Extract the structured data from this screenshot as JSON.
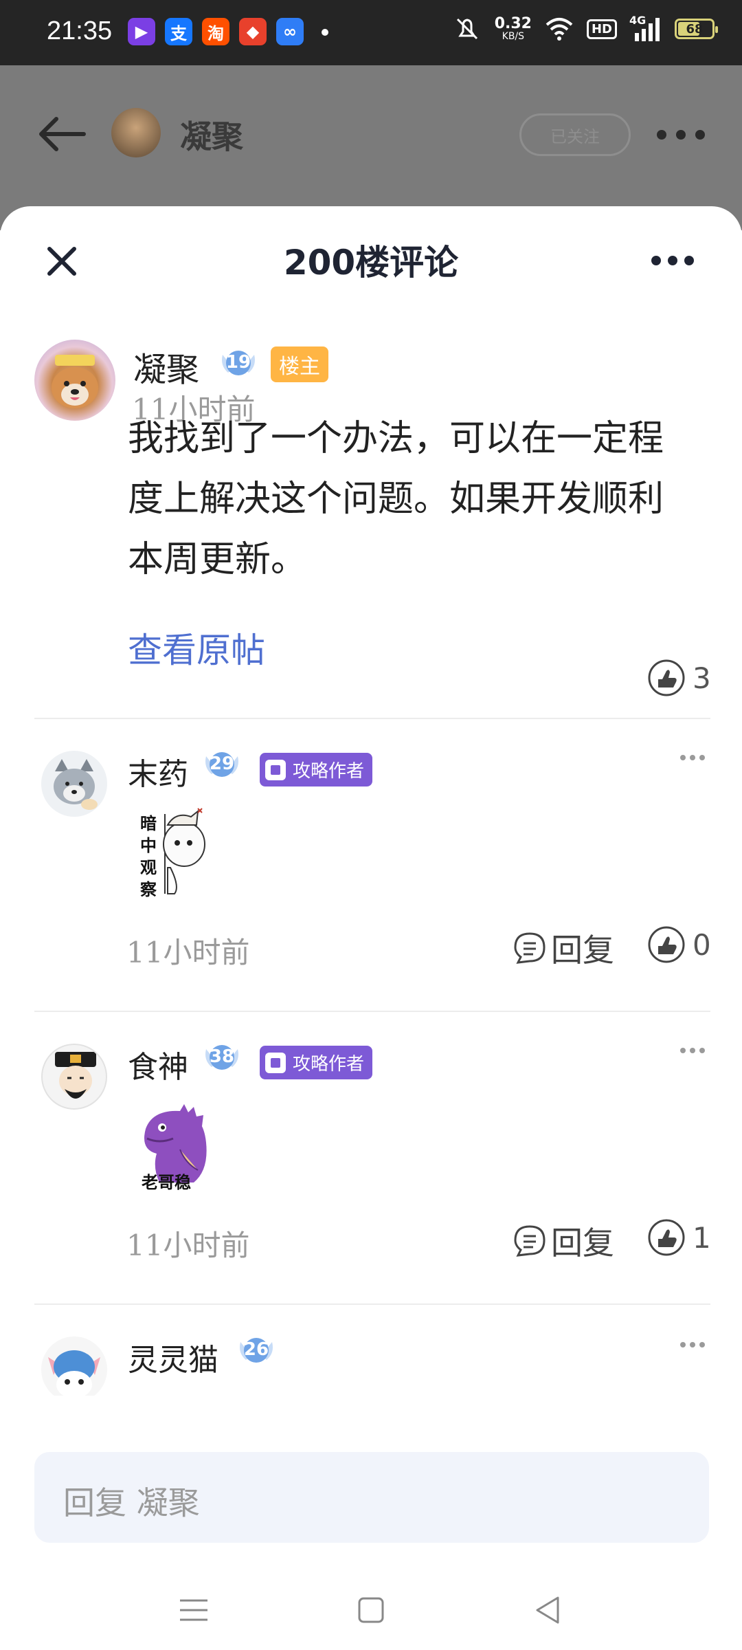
{
  "status_bar": {
    "time": "21:35",
    "apps": [
      {
        "icon": "video-app-icon",
        "glyph": "▶",
        "color": "#7b3fe4"
      },
      {
        "icon": "alipay-icon",
        "glyph": "支",
        "color": "#1677ff"
      },
      {
        "icon": "taobao-icon",
        "glyph": "淘",
        "color": "#ff5000"
      },
      {
        "icon": "app-icon-red",
        "glyph": "◆",
        "color": "#e8412c"
      },
      {
        "icon": "infinity-app-icon",
        "glyph": "∞",
        "color": "#2f7df6"
      }
    ],
    "net_speed_value": "0.32",
    "net_speed_unit": "KB/S",
    "hd": "HD",
    "signal_type": "4G",
    "battery": "68",
    "battery_level": 0.68
  },
  "background_header": {
    "name": "凝聚",
    "follow_label": "已关注"
  },
  "sheet": {
    "title": "200楼评论"
  },
  "main_post": {
    "name": "凝聚",
    "level": "19",
    "op_badge": "楼主",
    "time": "11小时前",
    "text": "我找到了一个办法，可以在一定程度上解决这个问题。如果开发顺利本周更新。",
    "view_post_label": "查看原帖",
    "likes": "3"
  },
  "replies": [
    {
      "name": "末药",
      "level": "29",
      "badge": "攻略作者",
      "sticker_text": "暗中观察",
      "time": "11小时前",
      "reply_label": "回复",
      "likes": "0"
    },
    {
      "name": "食神",
      "level": "38",
      "badge": "攻略作者",
      "sticker_text": "老哥稳",
      "time": "11小时前",
      "reply_label": "回复",
      "likes": "1"
    },
    {
      "name": "灵灵猫",
      "level": "26"
    }
  ],
  "reply_bar": {
    "placeholder": "回复 凝聚"
  },
  "colors": {
    "accent": "#4f6fd0",
    "op_badge": "#ffb544",
    "author_badge": "#7d5ad6"
  }
}
